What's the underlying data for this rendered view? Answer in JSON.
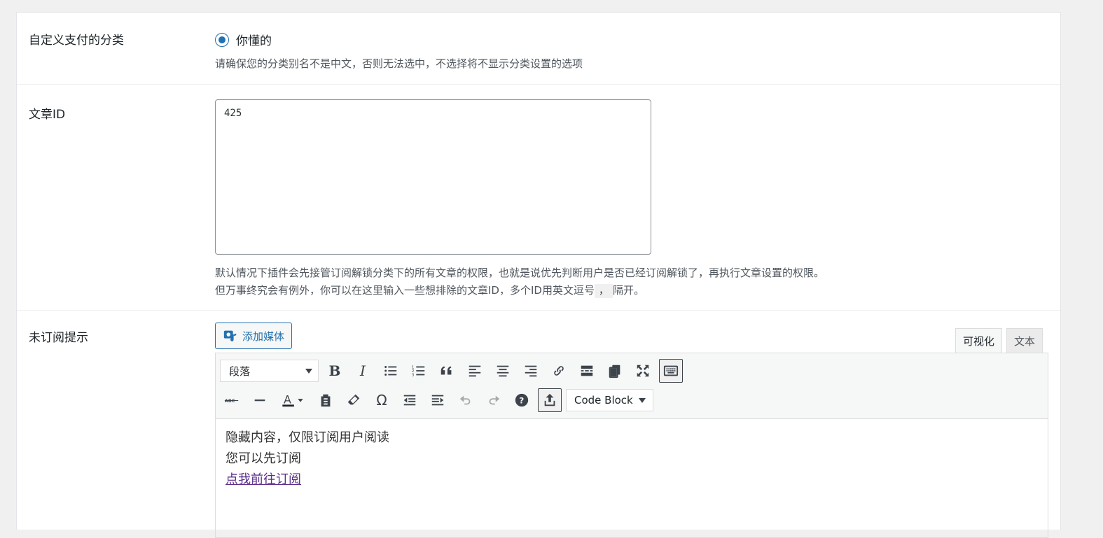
{
  "category_row": {
    "label": "自定义支付的分类",
    "radio_label": "你懂的",
    "description": "请确保您的分类别名不是中文，否则无法选中，不选择将不显示分类设置的选项"
  },
  "post_id_row": {
    "label": "文章ID",
    "value": "425",
    "description_line1": "默认情况下插件会先接管订阅解锁分类下的所有文章的权限，也就是说优先判断用户是否已经订阅解锁了，再执行文章设置的权限。",
    "description_line2_prefix": "但万事终究会有例外，你可以在这里输入一些想排除的文章ID，多个ID用英文逗号",
    "description_code": "，",
    "description_line2_suffix": "隔开。"
  },
  "unsub_row": {
    "label": "未订阅提示",
    "add_media_label": "添加媒体",
    "tab_visual": "可视化",
    "tab_text": "文本",
    "format_select": "段落",
    "code_block_select": "Code Block",
    "content_line1": "隐藏内容，仅限订阅用户阅读",
    "content_line2": "您可以先订阅",
    "content_link": "点我前往订阅"
  },
  "colors": {
    "accent": "#2271b1",
    "link": "#5b2d8a",
    "background": "#f0f0f1"
  }
}
